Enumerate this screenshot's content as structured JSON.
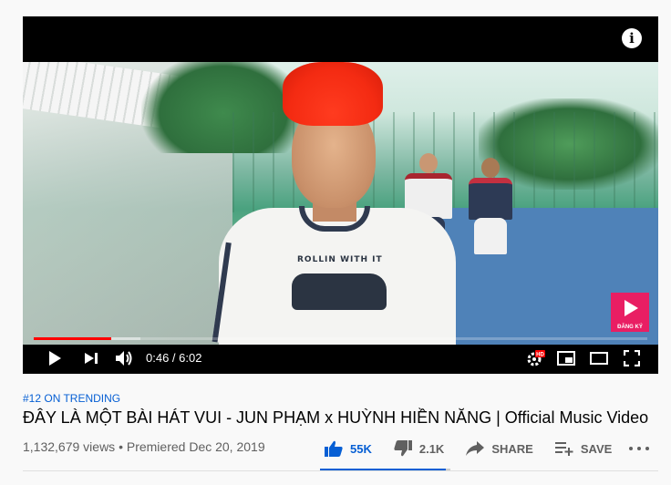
{
  "player": {
    "info_icon": "info-icon",
    "current_time": "0:46",
    "separator": " / ",
    "duration": "6:02",
    "played_fraction": 0.127,
    "loaded_fraction": 0.174,
    "watermark_label": "ĐĂNG KÝ",
    "shirt_text": "ROLLIN WITH IT",
    "controls": {
      "play": "play-icon",
      "next": "next-icon",
      "volume": "volume-icon",
      "settings": "settings-icon",
      "settings_badge": "HD",
      "miniplayer": "miniplayer-icon",
      "theater": "theater-icon",
      "fullscreen": "fullscreen-icon"
    }
  },
  "video": {
    "trending": "#12 ON TRENDING",
    "title": "ĐÂY LÀ MỘT BÀI HÁT VUI - JUN PHẠM x HUỲNH HIỀN NĂNG | Official Music Video",
    "stats": "1,132,679 views • Premiered Dec 20, 2019"
  },
  "actions": {
    "like_count": "55K",
    "dislike_count": "2.1K",
    "share_label": "SHARE",
    "save_label": "SAVE",
    "like_ratio": 0.963
  },
  "colors": {
    "accent_red": "#ff0000",
    "link_blue": "#065fd4",
    "text_secondary": "#606060",
    "background": "#f9f9f9"
  }
}
